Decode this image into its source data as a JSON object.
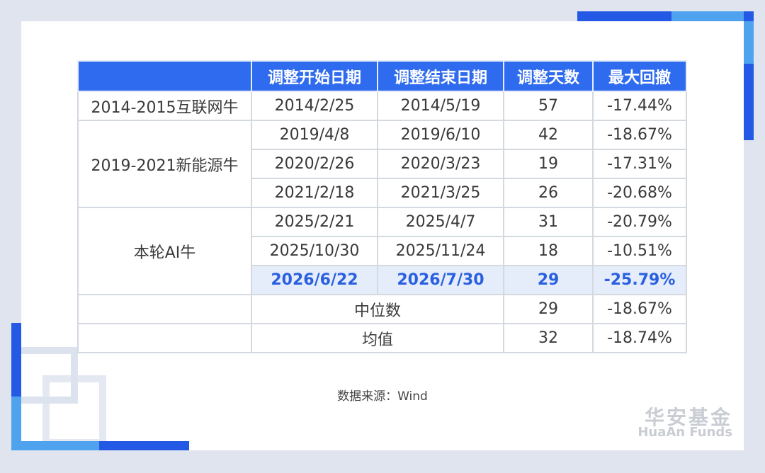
{
  "table": {
    "headers": [
      "",
      "调整开始日期",
      "调整结束日期",
      "调整天数",
      "最大回撤"
    ],
    "groups": [
      {
        "label": "2014-2015互联网牛"
      },
      {
        "label": "2019-2021新能源牛"
      },
      {
        "label": "本轮AI牛"
      }
    ],
    "rows": [
      {
        "start": "2014/2/25",
        "end": "2014/5/19",
        "days": "57",
        "drawdown": "-17.44%"
      },
      {
        "start": "2019/4/8",
        "end": "2019/6/10",
        "days": "42",
        "drawdown": "-18.67%"
      },
      {
        "start": "2020/2/26",
        "end": "2020/3/23",
        "days": "19",
        "drawdown": "-17.31%"
      },
      {
        "start": "2021/2/18",
        "end": "2021/3/25",
        "days": "26",
        "drawdown": "-20.68%"
      },
      {
        "start": "2025/2/21",
        "end": "2025/4/7",
        "days": "31",
        "drawdown": "-20.79%"
      },
      {
        "start": "2025/10/30",
        "end": "2025/11/24",
        "days": "18",
        "drawdown": "-10.51%"
      },
      {
        "start": "2026/6/22",
        "end": "2026/7/30",
        "days": "29",
        "drawdown": "-25.79%"
      }
    ],
    "summary": [
      {
        "label": "中位数",
        "days": "29",
        "drawdown": "-18.67%"
      },
      {
        "label": "均值",
        "days": "32",
        "drawdown": "-18.74%"
      }
    ],
    "header_color": "#2f6bee",
    "highlight_color": "#2a60e0"
  },
  "source": "数据来源：Wind",
  "logo": {
    "cn": "华安基金",
    "en": "HuaAn Funds"
  }
}
